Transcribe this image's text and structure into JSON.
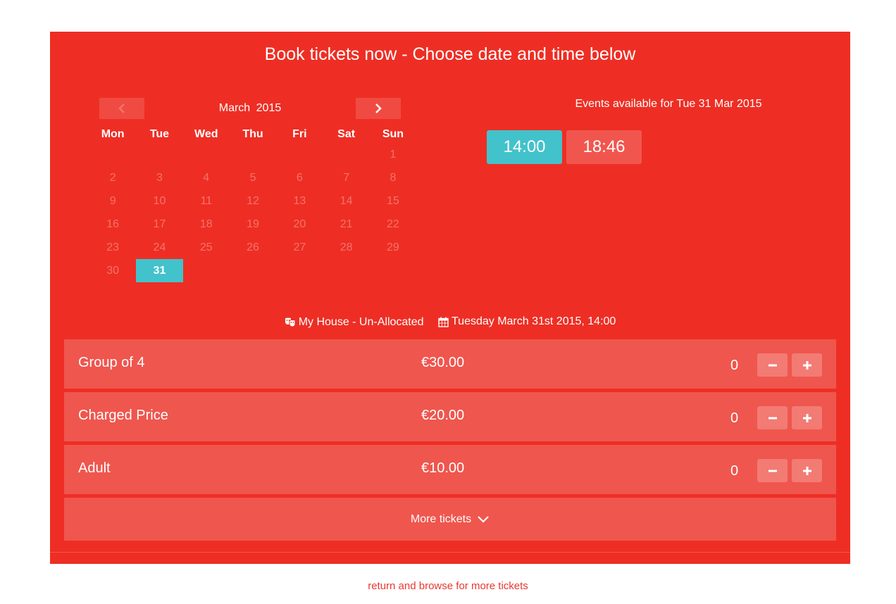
{
  "header": {
    "title": "Book tickets now - Choose date and time below"
  },
  "calendar": {
    "month": "March",
    "year": "2015",
    "weekdays": [
      "Mon",
      "Tue",
      "Wed",
      "Thu",
      "Fri",
      "Sat",
      "Sun"
    ],
    "days": [
      "",
      "",
      "",
      "",
      "",
      "",
      "1",
      "2",
      "3",
      "4",
      "5",
      "6",
      "7",
      "8",
      "9",
      "10",
      "11",
      "12",
      "13",
      "14",
      "15",
      "16",
      "17",
      "18",
      "19",
      "20",
      "21",
      "22",
      "23",
      "24",
      "25",
      "26",
      "27",
      "28",
      "29",
      "30",
      "31"
    ],
    "selected": "31"
  },
  "events": {
    "label": "Events available for Tue 31 Mar 2015",
    "times": [
      "14:00",
      "18:46"
    ],
    "selected_time": "14:00"
  },
  "event_info": {
    "venue": "My House - Un-Allocated",
    "datetime": "Tuesday March 31st 2015, 14:00"
  },
  "tickets": [
    {
      "name": "Group of 4",
      "price": "€30.00",
      "qty": "0"
    },
    {
      "name": "Charged Price",
      "price": "€20.00",
      "qty": "0"
    },
    {
      "name": "Adult",
      "price": "€10.00",
      "qty": "0"
    }
  ],
  "more_tickets": {
    "label": "More tickets"
  },
  "footer": {
    "link": "return and browse for more tickets"
  },
  "colors": {
    "panel": "#ee2e24",
    "accent": "#42c2cb",
    "row": "#ef564e"
  }
}
